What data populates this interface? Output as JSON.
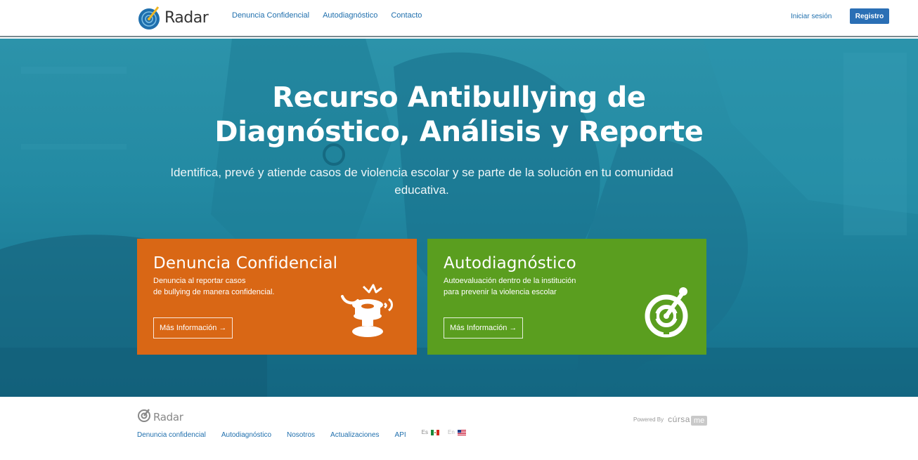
{
  "header": {
    "logo_text": "Radar",
    "nav": [
      "Denuncia Confidencial",
      "Autodiagnóstico",
      "Contacto"
    ],
    "login_label": "Iniciar sesión",
    "register_label": "Registro"
  },
  "hero": {
    "title_line1": "Recurso Antibullying de",
    "title_line2": "Diagnóstico, Análisis y Reporte",
    "subtitle": "Identifica, prevé y atiende casos de violencia escolar y se parte de la solución en tu comunidad educativa."
  },
  "cards": [
    {
      "title": "Denuncia Confidencial",
      "desc_line1": "Denuncia al reportar casos",
      "desc_line2": "de bullying de manera confidencial.",
      "button": "Más Información →",
      "color": "#d96715",
      "icon": "megaphone-icon"
    },
    {
      "title": "Autodiagnóstico",
      "desc_line1": "Autoevaluación dentro de la institución",
      "desc_line2": "para prevenir la violencia escolar",
      "button": "Más Información →",
      "color": "#5a9e1f",
      "icon": "target-icon"
    }
  ],
  "footer": {
    "logo_text": "Radar",
    "links": [
      "Denuncia confidencial",
      "Autodiagnóstico",
      "Nosotros",
      "Actualizaciones",
      "API"
    ],
    "lang_es": "Es",
    "lang_en": "En",
    "powered_label": "Powered By",
    "brand_cursa": "cúrsa",
    "brand_me": "me"
  },
  "colors": {
    "accent_blue": "#2a6fb5",
    "link_blue": "#1f6fad",
    "hero_teal": "#238aa3"
  }
}
